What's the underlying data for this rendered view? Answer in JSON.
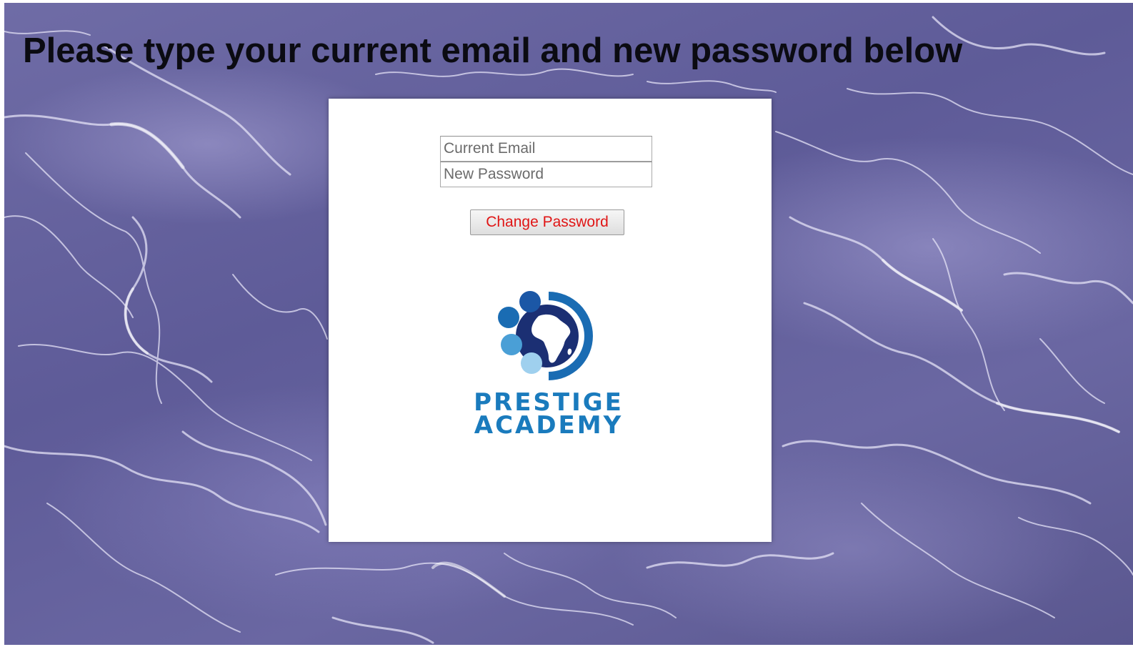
{
  "page": {
    "heading": "Please type your current email and new password below"
  },
  "form": {
    "email_placeholder": "Current Email",
    "password_placeholder": "New Password",
    "submit_label": "Change Password"
  },
  "logo": {
    "line1": "PRESTIGE",
    "line2": "ACADEMY",
    "icon": "globe-africa-icon"
  },
  "colors": {
    "background": "#6664a0",
    "button_text": "#e01515",
    "brand_blue": "#1a7bbd",
    "brand_navy": "#1b2f73"
  }
}
